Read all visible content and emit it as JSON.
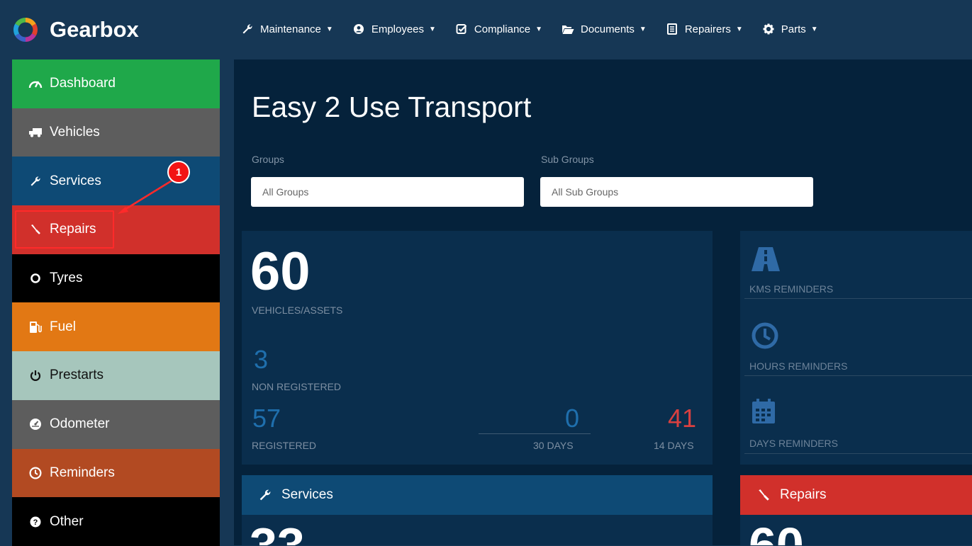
{
  "brand": {
    "name": "Gearbox"
  },
  "topnav": [
    {
      "label": "Maintenance",
      "icon": "wrench-icon"
    },
    {
      "label": "Employees",
      "icon": "user-circle-icon"
    },
    {
      "label": "Compliance",
      "icon": "check-square-icon"
    },
    {
      "label": "Documents",
      "icon": "folder-open-icon"
    },
    {
      "label": "Repairers",
      "icon": "list-box-icon"
    },
    {
      "label": "Parts",
      "icon": "gear-icon"
    }
  ],
  "sidebar": {
    "items": [
      {
        "label": "Dashboard",
        "icon": "gauge-icon",
        "color": "#1fa84a"
      },
      {
        "label": "Vehicles",
        "icon": "truck-icon",
        "color": "#5d5d5d"
      },
      {
        "label": "Services",
        "icon": "wrench-icon",
        "color": "#0e4a75"
      },
      {
        "label": "Repairs",
        "icon": "screwdriver-icon",
        "color": "#d1302b"
      },
      {
        "label": "Tyres",
        "icon": "ring-icon",
        "color": "#000000"
      },
      {
        "label": "Fuel",
        "icon": "fuel-pump-icon",
        "color": "#e27814"
      },
      {
        "label": "Prestarts",
        "icon": "power-icon",
        "color": "#a6c6bc"
      },
      {
        "label": "Odometer",
        "icon": "dashboard-dial-icon",
        "color": "#5d5d5d"
      },
      {
        "label": "Reminders",
        "icon": "clock-icon",
        "color": "#b24a22"
      },
      {
        "label": "Other",
        "icon": "question-circle-icon",
        "color": "#000000"
      }
    ]
  },
  "annotation": {
    "badge": "1"
  },
  "main": {
    "title": "Easy 2 Use Transport",
    "groups_label": "Groups",
    "groups_value": "All Groups",
    "subgroups_label": "Sub Groups",
    "subgroups_value": "All Sub Groups"
  },
  "vehicles_card": {
    "total": "60",
    "total_label": "VEHICLES/ASSETS",
    "non_registered": "3",
    "non_registered_label": "NON REGISTERED",
    "registered": "57",
    "registered_label": "REGISTERED",
    "days30": "0",
    "days30_label": "30 DAYS",
    "days14": "41",
    "days14_label": "14 DAYS"
  },
  "reminders_card": {
    "kms": "KMS REMINDERS",
    "hours": "HOURS REMINDERS",
    "days": "DAYS REMINDERS"
  },
  "panels": {
    "services": "Services",
    "repairs": "Repairs"
  },
  "colors": {
    "bg": "#163755",
    "main": "#05223b",
    "card": "#0a2e4d",
    "accent_blue": "#1f6fad",
    "accent_red": "#d94040"
  }
}
